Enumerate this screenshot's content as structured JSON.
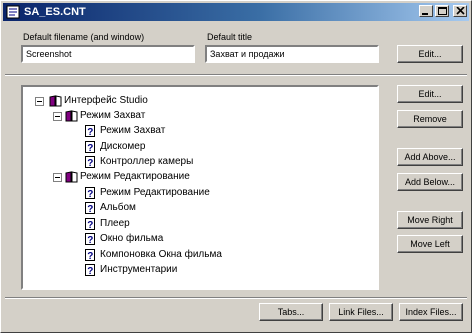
{
  "window": {
    "title": "SA_ES.CNT",
    "colors": {
      "titlebar": "#0a246a",
      "face": "#d4d0c8"
    }
  },
  "form": {
    "default_filename_label": "Default filename (and window)",
    "default_filename_value": "Screenshot",
    "default_title_label": "Default title",
    "default_title_value": "Захват и продажи",
    "edit_top_label": "Edit..."
  },
  "tree": [
    {
      "label": "Интерфейс Studio",
      "type": "book",
      "expander": "minus"
    },
    {
      "label": "Режим Захват",
      "type": "book",
      "expander": "minus"
    },
    {
      "label": "Режим Захват",
      "type": "page"
    },
    {
      "label": "Дискомер",
      "type": "page"
    },
    {
      "label": "Контроллер камеры",
      "type": "page"
    },
    {
      "label": "Режим Редактирование",
      "type": "book",
      "expander": "minus"
    },
    {
      "label": "Режим Редактирование",
      "type": "page"
    },
    {
      "label": "Альбом",
      "type": "page"
    },
    {
      "label": "Плеер",
      "type": "page"
    },
    {
      "label": "Окно фильма",
      "type": "page"
    },
    {
      "label": "Компоновка Окна фильма",
      "type": "page"
    },
    {
      "label": "Инструментарии",
      "type": "page"
    }
  ],
  "side_buttons": {
    "edit": "Edit...",
    "remove": "Remove",
    "add_above": "Add Above...",
    "add_below": "Add Below...",
    "move_right": "Move Right",
    "move_left": "Move Left"
  },
  "bottom_buttons": {
    "tabs": "Tabs...",
    "link_files": "Link Files...",
    "index_files": "Index Files..."
  }
}
